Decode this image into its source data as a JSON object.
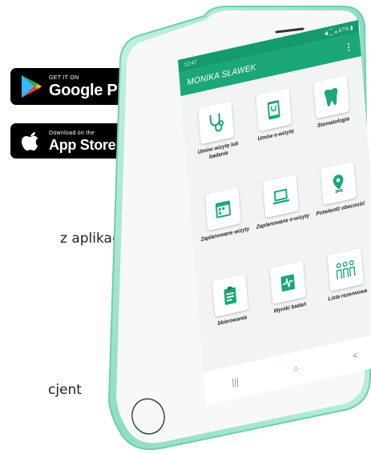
{
  "badges": {
    "google_play": {
      "small": "GET IT ON",
      "big": "Google Play"
    },
    "app_store": {
      "small": "Download on the",
      "big": "App Store"
    }
  },
  "background_text": {
    "line1": "z aplikację",
    "line2": "cjent"
  },
  "phone": {
    "status": {
      "time": "12:47",
      "right": "◀ ⁐ ▴ 67% ▮"
    },
    "app_title": "MONIKA SŁAWEK",
    "menu_icon": "⋮",
    "tiles": [
      {
        "label": "Umów wizytę lub badanie",
        "icon": "stethoscope-icon"
      },
      {
        "label": "Umów e-wizytę",
        "icon": "tablet-stethoscope-icon"
      },
      {
        "label": "Stomatologia",
        "icon": "tooth-icon"
      },
      {
        "label": "Zaplanowane wizyty",
        "icon": "calendar-icon"
      },
      {
        "label": "Zaplanowane e-wizyty",
        "icon": "laptop-icon"
      },
      {
        "label": "Potwierdź obecność",
        "icon": "location-pin-icon"
      },
      {
        "label": "Skierowania",
        "icon": "clipboard-icon"
      },
      {
        "label": "Wyniki badań",
        "icon": "ecg-folder-icon"
      },
      {
        "label": "Lista rezerwowa",
        "icon": "people-queue-icon"
      }
    ],
    "pager_dots": "•••",
    "nav": {
      "recent": "|||",
      "home": "○",
      "back": "<"
    }
  },
  "colors": {
    "accent": "#1ba777",
    "status": "#159a6e",
    "phone_frame": "#a8e8d2",
    "phone_body": "#f7f8f8"
  }
}
